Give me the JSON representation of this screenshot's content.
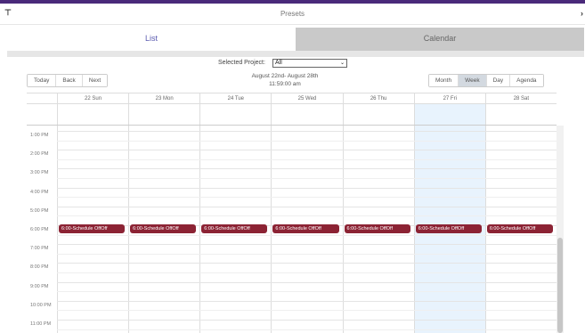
{
  "window": {
    "title": "Presets"
  },
  "tabs": [
    {
      "label": "List",
      "active": true
    },
    {
      "label": "Calendar",
      "active": false
    }
  ],
  "filter": {
    "label": "Selected Project:",
    "value": "All"
  },
  "toolbar": {
    "today": "Today",
    "back": "Back",
    "next": "Next",
    "views": [
      "Month",
      "Week",
      "Day",
      "Agenda"
    ],
    "active_view": "Week"
  },
  "range": {
    "line1": "August 22nd- August 28th",
    "line2": "11:59:00 am"
  },
  "days": [
    "22 Sun",
    "23 Mon",
    "24 Tue",
    "25 Wed",
    "26 Thu",
    "27 Fri",
    "28 Sat"
  ],
  "today_index": 5,
  "times": [
    "1:00 PM",
    "2:00 PM",
    "3:00 PM",
    "4:00 PM",
    "5:00 PM",
    "6:00 PM",
    "7:00 PM",
    "8:00 PM",
    "9:00 PM",
    "10:00 PM",
    "11:00 PM"
  ],
  "events": [
    {
      "day": 0,
      "time": "6:00 PM",
      "label": "6:00-Schedule OffOff"
    },
    {
      "day": 1,
      "time": "6:00 PM",
      "label": "6:00-Schedule OffOff"
    },
    {
      "day": 2,
      "time": "6:00 PM",
      "label": "6:00-Schedule OffOff"
    },
    {
      "day": 3,
      "time": "6:00 PM",
      "label": "6:00-Schedule OffOff"
    },
    {
      "day": 4,
      "time": "6:00 PM",
      "label": "6:00-Schedule OffOff"
    },
    {
      "day": 5,
      "time": "6:00 PM",
      "label": "6:00-Schedule OffOff"
    },
    {
      "day": 6,
      "time": "6:00 PM",
      "label": "6:00-Schedule OffOff"
    }
  ],
  "colors": {
    "accent": "#4a2a7a",
    "event": "#8c2334",
    "today_bg": "#e8f3fd"
  }
}
